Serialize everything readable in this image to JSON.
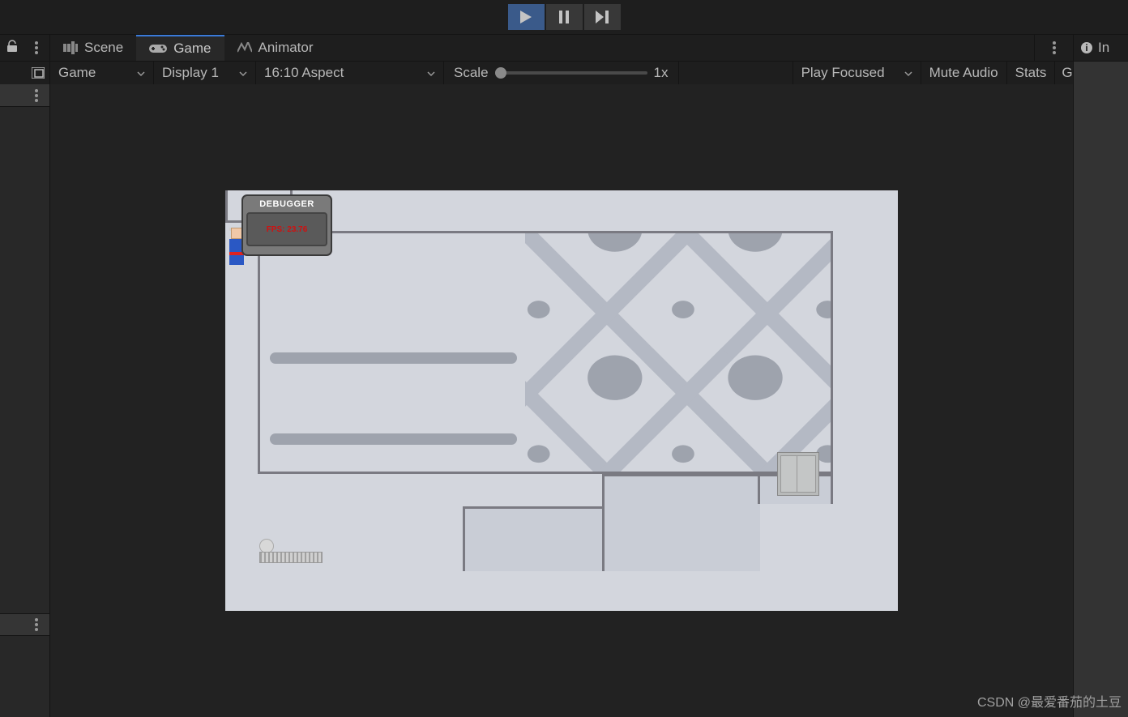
{
  "playback": {
    "play_active": true
  },
  "tabs": {
    "scene_label": "Scene",
    "game_label": "Game",
    "animator_label": "Animator"
  },
  "inspector_partial": "In",
  "game_controls": {
    "game": "Game",
    "display": "Display 1",
    "aspect": "16:10 Aspect",
    "scale_label": "Scale",
    "scale_value": "1x",
    "play_mode": "Play Focused",
    "mute": "Mute Audio",
    "stats": "Stats",
    "gizmos": "Gizmos"
  },
  "debugger": {
    "title": "DEBUGGER",
    "fps": "FPS: 23.76"
  },
  "watermark": "CSDN @最爱番茄的土豆"
}
